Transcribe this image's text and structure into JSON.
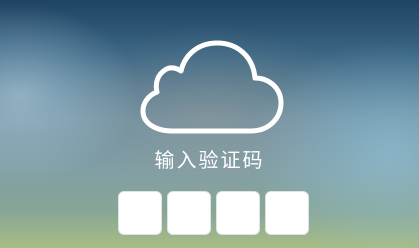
{
  "prompt_text": "输入验证码",
  "icon": "cloud-icon",
  "code_inputs": [
    {
      "value": ""
    },
    {
      "value": ""
    },
    {
      "value": ""
    },
    {
      "value": ""
    }
  ],
  "colors": {
    "icon_stroke": "#ffffff",
    "box_fill": "#ffffff",
    "text": "#ffffff"
  }
}
